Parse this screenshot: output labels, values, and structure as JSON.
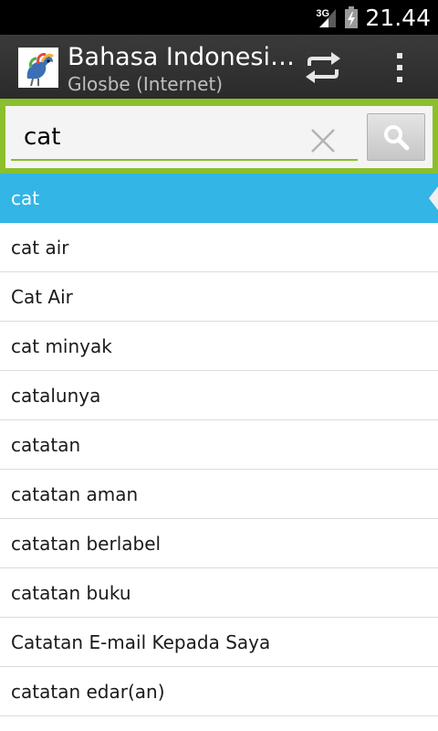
{
  "status_bar": {
    "network": "3G",
    "time": "21.44"
  },
  "action_bar": {
    "title": "Bahasa Indonesi…",
    "subtitle": "Glosbe (Internet)"
  },
  "search": {
    "value": "cat"
  },
  "results": [
    "cat",
    "cat air",
    "Cat Air",
    "cat minyak",
    "catalunya",
    "catatan",
    "catatan aman",
    "catatan berlabel",
    "catatan buku",
    "Catatan E-mail Kepada Saya",
    "catatan edar(an)"
  ],
  "colors": {
    "accent_green": "#8bbf2b",
    "selected_blue": "#33b5e5",
    "action_bar": "#333333"
  }
}
